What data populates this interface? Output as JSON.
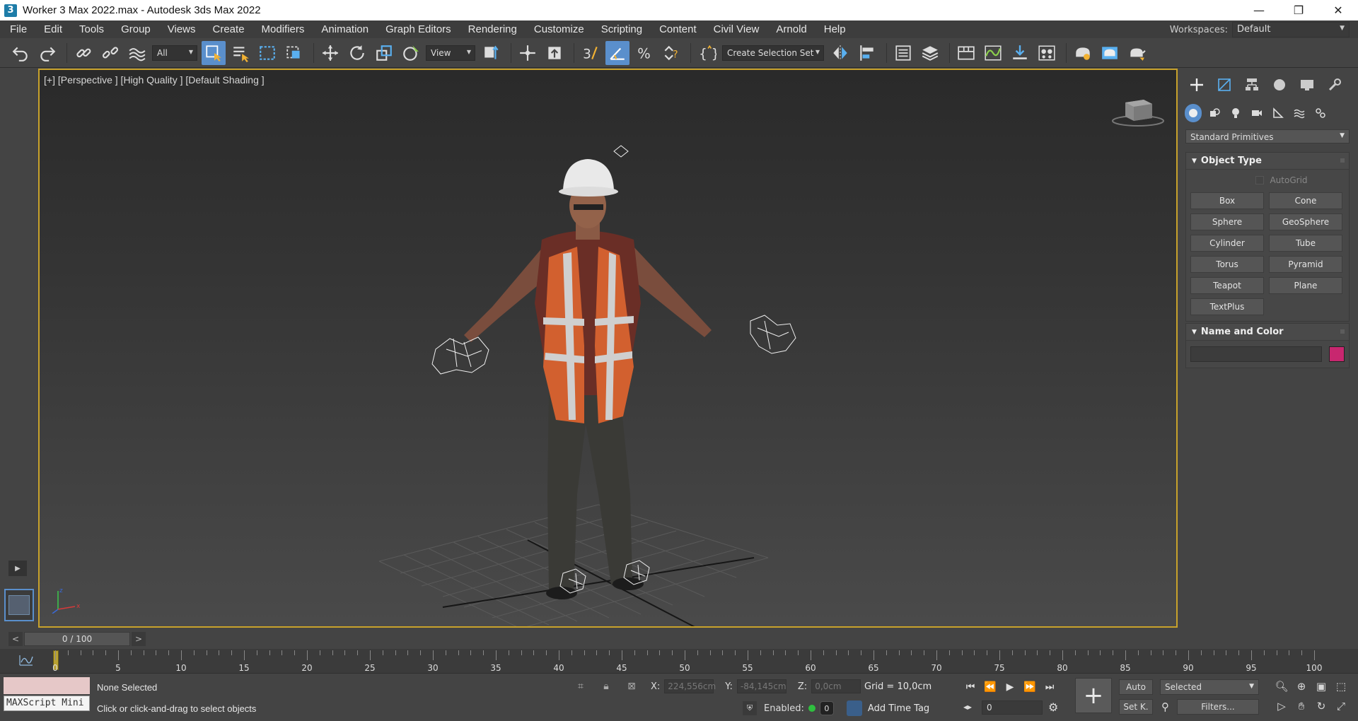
{
  "window": {
    "title": "Worker 3 Max 2022.max - Autodesk 3ds Max 2022",
    "minimize": "—",
    "restore": "❐",
    "close": "✕"
  },
  "menu": {
    "items": [
      "File",
      "Edit",
      "Tools",
      "Group",
      "Views",
      "Create",
      "Modifiers",
      "Animation",
      "Graph Editors",
      "Rendering",
      "Customize",
      "Scripting",
      "Content",
      "Civil View",
      "Arnold",
      "Help"
    ],
    "workspaces_label": "Workspaces:",
    "workspaces_value": "Default"
  },
  "toolbar": {
    "filter_value": "All",
    "ref_coord_value": "View",
    "selection_set_value": "Create Selection Set"
  },
  "viewport": {
    "label": "[+] [Perspective ] [High Quality ] [Default Shading ]"
  },
  "command_panel": {
    "category": "Standard Primitives",
    "object_type_title": "Object Type",
    "autogrid_label": "AutoGrid",
    "primitives": [
      "Box",
      "Cone",
      "Sphere",
      "GeoSphere",
      "Cylinder",
      "Tube",
      "Torus",
      "Pyramid",
      "Teapot",
      "Plane",
      "TextPlus"
    ],
    "name_color_title": "Name and Color",
    "swatch_color": "#c8276f"
  },
  "time_slider": {
    "prev": "<",
    "value": "0 / 100",
    "next": ">"
  },
  "track_bar": {
    "labels": [
      "0",
      "5",
      "10",
      "15",
      "20",
      "25",
      "30",
      "35",
      "40",
      "45",
      "50",
      "55",
      "60",
      "65",
      "70",
      "75",
      "80",
      "85",
      "90",
      "95",
      "100"
    ]
  },
  "status": {
    "maxscript_label": "MAXScript Mini",
    "selection": "None Selected",
    "prompt": "Click or click-and-drag to select objects",
    "x_label": "X:",
    "x_value": "224,556cm",
    "y_label": "Y:",
    "y_value": "-84,145cm",
    "z_label": "Z:",
    "z_value": "0,0cm",
    "grid": "Grid = 10,0cm",
    "enabled_label": "Enabled:",
    "enabled_count": "0",
    "add_time_tag": "Add Time Tag",
    "frame_value": "0",
    "auto_label": "Auto",
    "setkey_label": "Set K.",
    "key_filter_value": "Selected",
    "filters_label": "Filters..."
  }
}
